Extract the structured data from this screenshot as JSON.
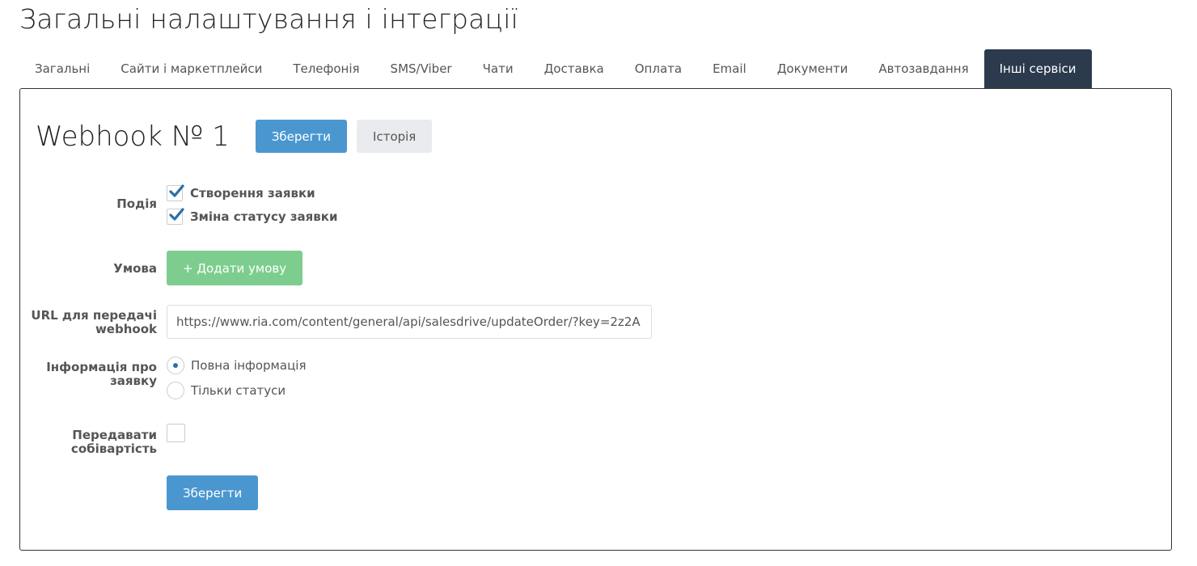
{
  "page_title": "Загальні налаштування і інтеграції",
  "tabs": [
    {
      "label": "Загальні",
      "active": false
    },
    {
      "label": "Сайти і маркетплейси",
      "active": false
    },
    {
      "label": "Телефонія",
      "active": false
    },
    {
      "label": "SMS/Viber",
      "active": false
    },
    {
      "label": "Чати",
      "active": false
    },
    {
      "label": "Доставка",
      "active": false
    },
    {
      "label": "Оплата",
      "active": false
    },
    {
      "label": "Email",
      "active": false
    },
    {
      "label": "Документи",
      "active": false
    },
    {
      "label": "Автозавдання",
      "active": false
    },
    {
      "label": "Інші сервіси",
      "active": true
    }
  ],
  "webhook": {
    "title": "Webhook № 1",
    "save_label": "Зберегти",
    "history_label": "Історія"
  },
  "form": {
    "event": {
      "label": "Подія",
      "options": [
        {
          "label": "Створення заявки",
          "checked": true
        },
        {
          "label": "Зміна статусу заявки",
          "checked": true
        }
      ]
    },
    "condition": {
      "label": "Умова",
      "add_label": "+ Додати умову"
    },
    "url": {
      "label": "URL для передачі webhook",
      "value": "https://www.ria.com/content/general/api/salesdrive/updateOrder/?key=2z2A"
    },
    "info": {
      "label": "Інформація про заявку",
      "options": [
        {
          "label": "Повна інформація",
          "selected": true
        },
        {
          "label": "Тільки статуси",
          "selected": false
        }
      ]
    },
    "cost": {
      "label": "Передавати собівартість",
      "checked": false
    },
    "submit_label": "Зберегти"
  },
  "colors": {
    "primary": "#4a97d0",
    "success": "#7dce8e",
    "active_tab": "#2b3a4d",
    "check": "#2a6fa8"
  }
}
